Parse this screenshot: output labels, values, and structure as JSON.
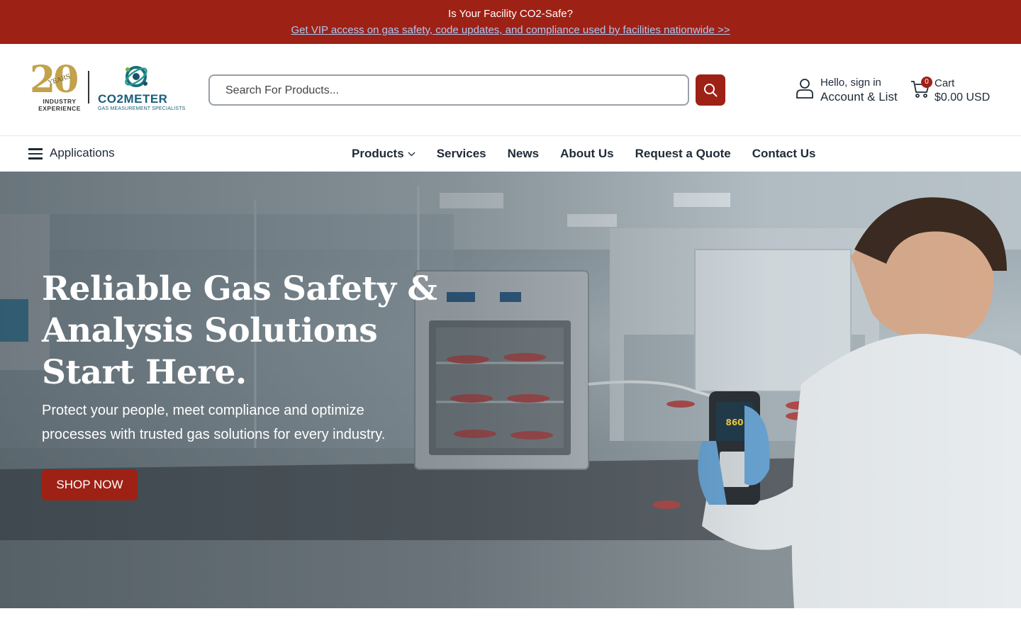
{
  "announcement": {
    "title": "Is Your Facility CO2-Safe?",
    "link_text": "Get VIP access on gas safety, code updates, and compliance used by facilities nationwide >>"
  },
  "logo": {
    "years_number": "20",
    "years_word": "YEARS",
    "experience_text": "INDUSTRY EXPERIENCE",
    "brand_name": "CO2METER",
    "brand_tagline": "GAS MEASUREMENT SPECIALISTS"
  },
  "search": {
    "placeholder": "Search For Products..."
  },
  "account": {
    "greeting": "Hello, sign in",
    "label": "Account & List"
  },
  "cart": {
    "count": "0",
    "label": "Cart",
    "total": "$0.00 USD"
  },
  "nav": {
    "applications_label": "Applications",
    "items": [
      {
        "label": "Products"
      },
      {
        "label": "Services"
      },
      {
        "label": "News"
      },
      {
        "label": "About Us"
      },
      {
        "label": "Request a Quote"
      },
      {
        "label": "Contact Us"
      }
    ]
  },
  "hero": {
    "title": "Reliable Gas Safety & Analysis Solutions Start Here.",
    "subtitle": "Protect your people, meet compliance and optimize processes with trusted gas solutions for every industry.",
    "button_label": "SHOP NOW",
    "device_reading": "860"
  },
  "colors": {
    "brand_red": "#9e2116",
    "link_blue": "#a9c8f2",
    "text_dark": "#1f2a37"
  }
}
